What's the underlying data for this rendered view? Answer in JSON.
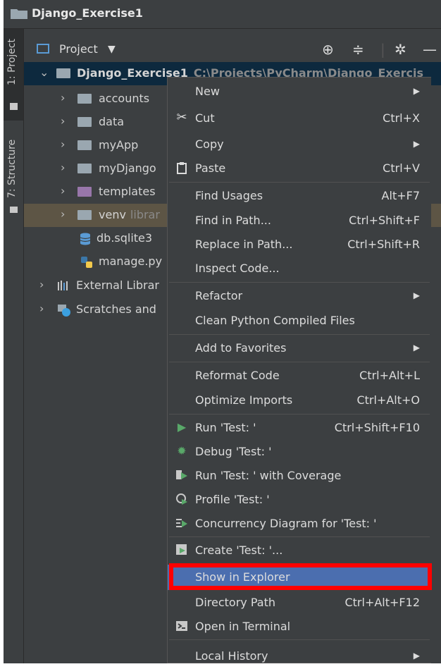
{
  "window": {
    "title": "Django_Exercise1"
  },
  "side_tabs": [
    {
      "label": "1: Project",
      "icon": "folder-icon"
    },
    {
      "label": "7: Structure",
      "icon": "structure-icon"
    }
  ],
  "panel": {
    "title": "Project",
    "caret": "▼"
  },
  "tree": [
    {
      "label": "Django_Exercise1",
      "path": "C:\\Projects\\PyCharm\\Django_Exercis",
      "icon": "folder-icon"
    },
    {
      "label": "accounts",
      "icon": "package-folder-icon"
    },
    {
      "label": "data",
      "icon": "folder-icon"
    },
    {
      "label": "myApp",
      "icon": "package-folder-icon"
    },
    {
      "label": "myDjango",
      "icon": "package-folder-icon"
    },
    {
      "label": "templates",
      "icon": "templates-folder-icon"
    },
    {
      "label": "venv",
      "path": "librar",
      "icon": "folder-icon"
    },
    {
      "label": "db.sqlite3",
      "icon": "database-icon"
    },
    {
      "label": "manage.py",
      "icon": "python-file-icon"
    },
    {
      "label": "External Librar",
      "icon": "library-icon"
    },
    {
      "label": "Scratches and",
      "icon": "scratch-icon"
    }
  ],
  "menu": {
    "items": [
      {
        "label": "New",
        "shortcut": "",
        "submenu": true,
        "icon": ""
      },
      {
        "label": "Cut",
        "shortcut": "Ctrl+X",
        "icon": "scissors-icon"
      },
      {
        "label": "Copy",
        "shortcut": "",
        "submenu": true,
        "icon": ""
      },
      {
        "label": "Paste",
        "shortcut": "Ctrl+V",
        "icon": "clipboard-icon"
      },
      {
        "label": "Find Usages",
        "shortcut": "Alt+F7",
        "icon": ""
      },
      {
        "label": "Find in Path...",
        "shortcut": "Ctrl+Shift+F",
        "icon": ""
      },
      {
        "label": "Replace in Path...",
        "shortcut": "Ctrl+Shift+R",
        "icon": ""
      },
      {
        "label": "Inspect Code...",
        "shortcut": "",
        "icon": ""
      },
      {
        "label": "Refactor",
        "shortcut": "",
        "submenu": true,
        "icon": ""
      },
      {
        "label": "Clean Python Compiled Files",
        "shortcut": "",
        "icon": ""
      },
      {
        "label": "Add to Favorites",
        "shortcut": "",
        "submenu": true,
        "icon": ""
      },
      {
        "label": "Reformat Code",
        "shortcut": "Ctrl+Alt+L",
        "icon": ""
      },
      {
        "label": "Optimize Imports",
        "shortcut": "Ctrl+Alt+O",
        "icon": ""
      },
      {
        "label": "Run 'Test: '",
        "shortcut": "Ctrl+Shift+F10",
        "icon": "run-icon"
      },
      {
        "label": "Debug 'Test: '",
        "shortcut": "",
        "icon": "debug-icon"
      },
      {
        "label": "Run 'Test: ' with Coverage",
        "shortcut": "",
        "icon": "coverage-icon"
      },
      {
        "label": "Profile 'Test: '",
        "shortcut": "",
        "icon": "profile-icon"
      },
      {
        "label": "Concurrency Diagram for 'Test: '",
        "shortcut": "",
        "icon": "concurrency-icon"
      },
      {
        "label": "Create 'Test: '...",
        "shortcut": "",
        "icon": "create-config-icon"
      },
      {
        "label": "Show in Explorer",
        "shortcut": "",
        "icon": ""
      },
      {
        "label": "Directory Path",
        "shortcut": "Ctrl+Alt+F12",
        "icon": ""
      },
      {
        "label": "Open in Terminal",
        "shortcut": "",
        "icon": "terminal-icon"
      },
      {
        "label": "Local History",
        "shortcut": "",
        "submenu": true,
        "icon": ""
      }
    ]
  },
  "highlight": {
    "item": "Show in Explorer",
    "color": "#ff0000"
  },
  "colors": {
    "menu_highlight": "#4b6eaf",
    "background": "#3c3f41",
    "selected_row": "#0d293e"
  }
}
